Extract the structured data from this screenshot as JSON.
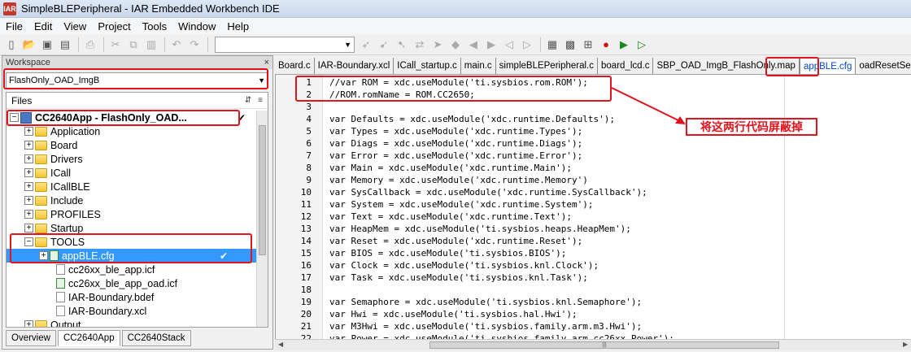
{
  "window": {
    "title": "SimpleBLEPeripheral - IAR Embedded Workbench IDE",
    "app_icon_label": "IAR"
  },
  "menu": [
    "File",
    "Edit",
    "View",
    "Project",
    "Tools",
    "Window",
    "Help"
  ],
  "toolbar": {
    "combo_value": ""
  },
  "workspace": {
    "header": "Workspace",
    "close_glyph": "×",
    "configuration": "FlashOnly_OAD_ImgB",
    "files_label": "Files",
    "tree": [
      {
        "label": "CC2640App - FlashOnly_OAD...",
        "bold": true,
        "check": "✔",
        "type": "project",
        "expander": "−"
      },
      {
        "label": "Application",
        "type": "folder",
        "expander": "+"
      },
      {
        "label": "Board",
        "type": "folder-x",
        "expander": "+"
      },
      {
        "label": "Drivers",
        "type": "folder",
        "expander": "+"
      },
      {
        "label": "ICall",
        "type": "folder",
        "expander": "+"
      },
      {
        "label": "ICallBLE",
        "type": "folder",
        "expander": "+"
      },
      {
        "label": "Include",
        "type": "folder",
        "expander": "+"
      },
      {
        "label": "PROFILES",
        "type": "folder",
        "expander": "+"
      },
      {
        "label": "Startup",
        "type": "folder",
        "expander": "+"
      },
      {
        "label": "TOOLS",
        "type": "folder",
        "expander": "−"
      },
      {
        "label": "appBLE.cfg",
        "type": "file-green",
        "expander": "+",
        "selected": true,
        "check": "✔"
      },
      {
        "label": "cc26xx_ble_app.icf",
        "type": "file-x"
      },
      {
        "label": "cc26xx_ble_app_oad.icf",
        "type": "file-green"
      },
      {
        "label": "IAR-Boundary.bdef",
        "type": "file-x"
      },
      {
        "label": "IAR-Boundary.xcl",
        "type": "file-x"
      },
      {
        "label": "Output",
        "type": "folder",
        "expander": "+"
      }
    ],
    "tabs": [
      "Overview",
      "CC2640App",
      "CC2640Stack"
    ],
    "active_tab": "CC2640App"
  },
  "editor": {
    "tabs": [
      "Board.c",
      "IAR-Boundary.xcl",
      "ICall_startup.c",
      "main.c",
      "simpleBLEPeripheral.c",
      "board_lcd.c",
      "SBP_OAD_ImgB_FlashOnly.map",
      "appBLE.cfg",
      "oadResetService.c"
    ],
    "active_tab": "appBLE.cfg",
    "lines": [
      {
        "n": "1",
        "code": "//var ROM = xdc.useModule('ti.sysbios.rom.ROM');"
      },
      {
        "n": "2",
        "code": "//ROM.romName = ROM.CC2650;"
      },
      {
        "n": "3",
        "code": ""
      },
      {
        "n": "4",
        "code": "var Defaults = xdc.useModule('xdc.runtime.Defaults');"
      },
      {
        "n": "5",
        "code": "var Types = xdc.useModule('xdc.runtime.Types');"
      },
      {
        "n": "6",
        "code": "var Diags = xdc.useModule('xdc.runtime.Diags');"
      },
      {
        "n": "7",
        "code": "var Error = xdc.useModule('xdc.runtime.Error');"
      },
      {
        "n": "8",
        "code": "var Main = xdc.useModule('xdc.runtime.Main');"
      },
      {
        "n": "9",
        "code": "var Memory = xdc.useModule('xdc.runtime.Memory')"
      },
      {
        "n": "10",
        "code": "var SysCallback = xdc.useModule('xdc.runtime.SysCallback');"
      },
      {
        "n": "11",
        "code": "var System = xdc.useModule('xdc.runtime.System');"
      },
      {
        "n": "12",
        "code": "var Text = xdc.useModule('xdc.runtime.Text');"
      },
      {
        "n": "13",
        "code": "var HeapMem = xdc.useModule('ti.sysbios.heaps.HeapMem');"
      },
      {
        "n": "14",
        "code": "var Reset = xdc.useModule('xdc.runtime.Reset');"
      },
      {
        "n": "15",
        "code": "var BIOS = xdc.useModule('ti.sysbios.BIOS');"
      },
      {
        "n": "16",
        "code": "var Clock = xdc.useModule('ti.sysbios.knl.Clock');"
      },
      {
        "n": "17",
        "code": "var Task = xdc.useModule('ti.sysbios.knl.Task');"
      },
      {
        "n": "18",
        "code": ""
      },
      {
        "n": "19",
        "code": "var Semaphore = xdc.useModule('ti.sysbios.knl.Semaphore');"
      },
      {
        "n": "20",
        "code": "var Hwi = xdc.useModule('ti.sysbios.hal.Hwi');"
      },
      {
        "n": "21",
        "code": "var M3Hwi = xdc.useModule('ti.sysbios.family.arm.m3.Hwi');"
      },
      {
        "n": "22",
        "code": "var Power = xdc.useModule('ti.sysbios.family.arm.cc26xx.Power');"
      }
    ]
  },
  "annotation": {
    "text": "将这两行代码屏蔽掉",
    "color": "#e0141e"
  },
  "hscroll_grip": "|||"
}
